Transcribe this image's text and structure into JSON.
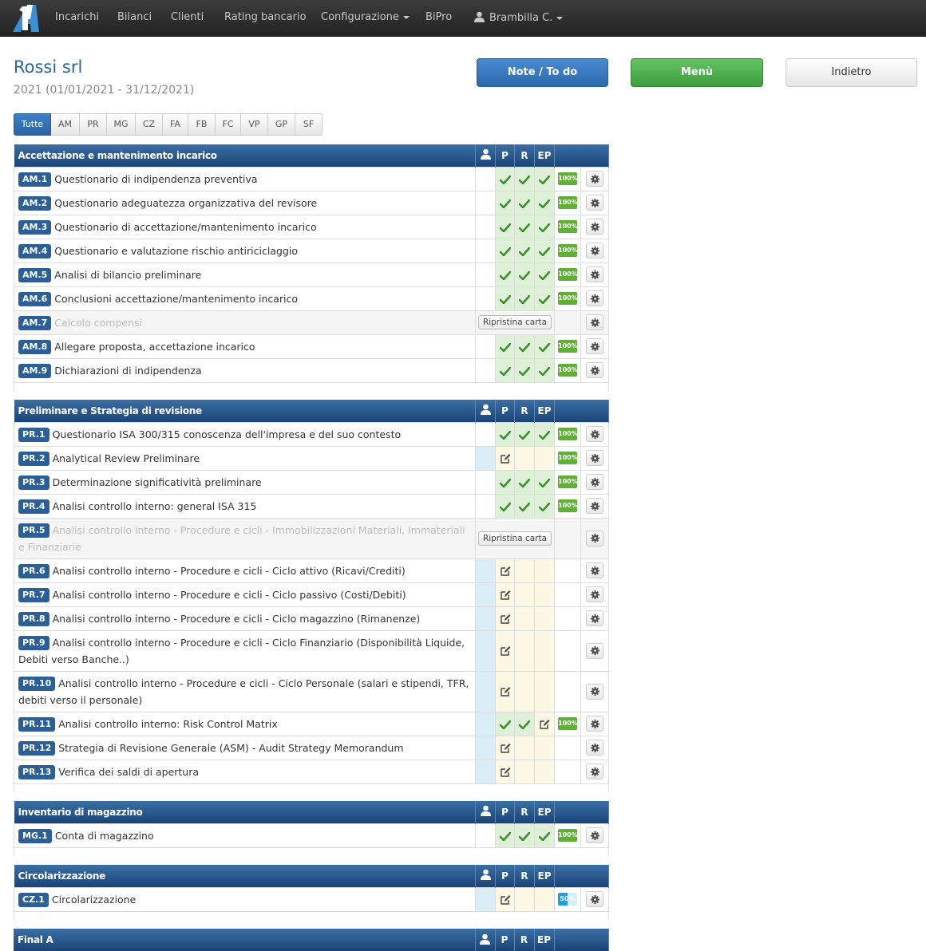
{
  "nav": {
    "items": [
      "Incarichi",
      "Bilanci",
      "Clienti",
      "Rating bancario",
      "Configurazione",
      "BiPro"
    ],
    "user": "Brambilla C."
  },
  "header": {
    "title": "Rossi srl",
    "subtitle": "2021 (01/01/2021 - 31/12/2021)",
    "btn_note": "Note / To do",
    "btn_menu": "Menù",
    "btn_back": "Indietro"
  },
  "filters": {
    "tabs": [
      "Tutte",
      "AM",
      "PR",
      "MG",
      "CZ",
      "FA",
      "FB",
      "FC",
      "VP",
      "GP",
      "SF"
    ],
    "active": "Tutte"
  },
  "columns": {
    "p": "P",
    "r": "R",
    "ep": "EP"
  },
  "restore_label": "Ripristina carta",
  "colors": {
    "accent": "#2a5f97",
    "complete": "#5eb135",
    "in_progress": "#1d9fe0"
  },
  "sections": [
    {
      "title": "Accettazione e mantenimento incarico",
      "rows": [
        {
          "code": "AM.1",
          "label": "Questionario di indipendenza preventiva",
          "u": "",
          "p": "check",
          "r": "check",
          "ep": "check",
          "pct": "100%"
        },
        {
          "code": "AM.2",
          "label": "Questionario adeguatezza organizzativa del revisore",
          "u": "",
          "p": "check",
          "r": "check",
          "ep": "check",
          "pct": "100%"
        },
        {
          "code": "AM.3",
          "label": "Questionario di accettazione/mantenimento incarico",
          "u": "",
          "p": "check",
          "r": "check",
          "ep": "check",
          "pct": "100%"
        },
        {
          "code": "AM.4",
          "label": "Questionario e valutazione rischio antiriciclaggio",
          "u": "",
          "p": "check",
          "r": "check",
          "ep": "check",
          "pct": "100%"
        },
        {
          "code": "AM.5",
          "label": "Analisi di bilancio preliminare",
          "u": "",
          "p": "check",
          "r": "check",
          "ep": "check",
          "pct": "100%"
        },
        {
          "code": "AM.6",
          "label": "Conclusioni accettazione/mantenimento incarico",
          "u": "",
          "p": "check",
          "r": "check",
          "ep": "check",
          "pct": "100%"
        },
        {
          "code": "AM.7",
          "label": "Calcolo compensi",
          "disabled": true
        },
        {
          "code": "AM.8",
          "label": "Allegare proposta, accettazione incarico",
          "u": "",
          "p": "check",
          "r": "check",
          "ep": "check",
          "pct": "100%"
        },
        {
          "code": "AM.9",
          "label": "Dichiarazioni di indipendenza",
          "u": "",
          "p": "check",
          "r": "check",
          "ep": "check",
          "pct": "100%"
        }
      ]
    },
    {
      "title": "Preliminare e Strategia di revisione",
      "rows": [
        {
          "code": "PR.1",
          "label": "Questionario ISA 300/315 conoscenza dell'impresa e del suo contesto",
          "u": "",
          "p": "check",
          "r": "check",
          "ep": "check",
          "pct": "100%"
        },
        {
          "code": "PR.2",
          "label": "Analytical Review Preliminare",
          "u": "wip",
          "p": "edit",
          "r": "wip",
          "ep": "wip",
          "pct": "100%"
        },
        {
          "code": "PR.3",
          "label": "Determinazione significatività preliminare",
          "u": "",
          "p": "check",
          "r": "check",
          "ep": "check",
          "pct": "100%"
        },
        {
          "code": "PR.4",
          "label": "Analisi controllo interno: general ISA 315",
          "u": "",
          "p": "check",
          "r": "check",
          "ep": "check",
          "pct": "100%"
        },
        {
          "code": "PR.5",
          "label": "Analisi controllo interno - Procedure e cicli - Immobilizzazioni Materiali, Immateriali e Finanziarie",
          "disabled": true
        },
        {
          "code": "PR.6",
          "label": "Analisi controllo interno - Procedure e cicli - Ciclo attivo (Ricavi/Crediti)",
          "u": "wip",
          "p": "edit",
          "r": "wip",
          "ep": "wip",
          "pct": ""
        },
        {
          "code": "PR.7",
          "label": "Analisi controllo interno - Procedure e cicli - Ciclo passivo (Costi/Debiti)",
          "u": "wip",
          "p": "edit",
          "r": "wip",
          "ep": "wip",
          "pct": ""
        },
        {
          "code": "PR.8",
          "label": "Analisi controllo interno - Procedure e cicli - Ciclo magazzino (Rimanenze)",
          "u": "wip",
          "p": "edit",
          "r": "wip",
          "ep": "wip",
          "pct": ""
        },
        {
          "code": "PR.9",
          "label": "Analisi controllo interno - Procedure e cicli - Ciclo Finanziario (Disponibilità Liquide, Debiti verso Banche..)",
          "u": "wip",
          "p": "edit",
          "r": "wip",
          "ep": "wip",
          "pct": ""
        },
        {
          "code": "PR.10",
          "label": "Analisi controllo interno - Procedure e cicli - Ciclo Personale (salari e stipendi, TFR, debiti verso il personale)",
          "u": "wip",
          "p": "edit",
          "r": "wip",
          "ep": "wip",
          "pct": ""
        },
        {
          "code": "PR.11",
          "label": "Analisi controllo interno: Risk Control Matrix",
          "u": "wip",
          "p": "check",
          "r": "check",
          "ep": "edit",
          "pct": "100%"
        },
        {
          "code": "PR.12",
          "label": "Strategia di Revisione Generale (ASM) - Audit Strategy Memorandum",
          "u": "wip",
          "p": "edit",
          "r": "wip",
          "ep": "wip",
          "pct": ""
        },
        {
          "code": "PR.13",
          "label": "Verifica dei saldi di apertura",
          "u": "wip",
          "p": "edit",
          "r": "wip",
          "ep": "wip",
          "pct": ""
        }
      ]
    },
    {
      "title": "Inventario di magazzino",
      "rows": [
        {
          "code": "MG.1",
          "label": "Conta di magazzino",
          "u": "",
          "p": "check",
          "r": "check",
          "ep": "check",
          "pct": "100%"
        }
      ]
    },
    {
      "title": "Circolarizzazione",
      "rows": [
        {
          "code": "CZ.1",
          "label": "Circolarizzazione",
          "u": "wip",
          "p": "edit",
          "r": "wip",
          "ep": "wip",
          "pct": "50%"
        }
      ]
    },
    {
      "title": "Final A",
      "rows": []
    }
  ]
}
